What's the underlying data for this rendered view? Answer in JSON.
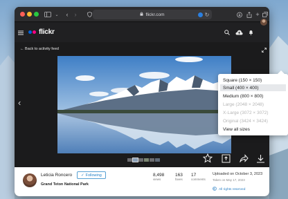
{
  "browser": {
    "url": "flickr.com",
    "colors": {
      "close": "#ff5f57",
      "minimize": "#febc2e",
      "maximize": "#28c840"
    }
  },
  "navbar": {
    "logo_text": "flickr",
    "logo_colors": [
      "#0063dc",
      "#ff0084"
    ]
  },
  "viewer": {
    "back_link": "Back to activity feed"
  },
  "photo_info": {
    "owner_name": "Leticia Roncero",
    "follow_label": "Following",
    "follow_check": "✓",
    "location": "Grand Teton National Park",
    "stats": [
      {
        "value": "8,498",
        "label": "views"
      },
      {
        "value": "163",
        "label": "faves"
      },
      {
        "value": "17",
        "label": "comments"
      }
    ],
    "uploaded": "Uploaded on October 3, 2023",
    "taken": "Taken on May 17, 2023",
    "rights": "All rights reserved"
  },
  "download_menu": {
    "items": [
      {
        "label": "Square (150 × 150)",
        "state": "enabled"
      },
      {
        "label": "Small (400 × 400)",
        "state": "highlighted"
      },
      {
        "label": "Medium (800 × 800)",
        "state": "enabled"
      },
      {
        "label": "Large (2048 × 2048)",
        "state": "disabled"
      },
      {
        "label": "X-Large (3072 × 3072)",
        "state": "disabled"
      },
      {
        "label": "Original (3424 × 3424)",
        "state": "disabled"
      },
      {
        "label": "View all sizes",
        "state": "enabled"
      }
    ]
  }
}
